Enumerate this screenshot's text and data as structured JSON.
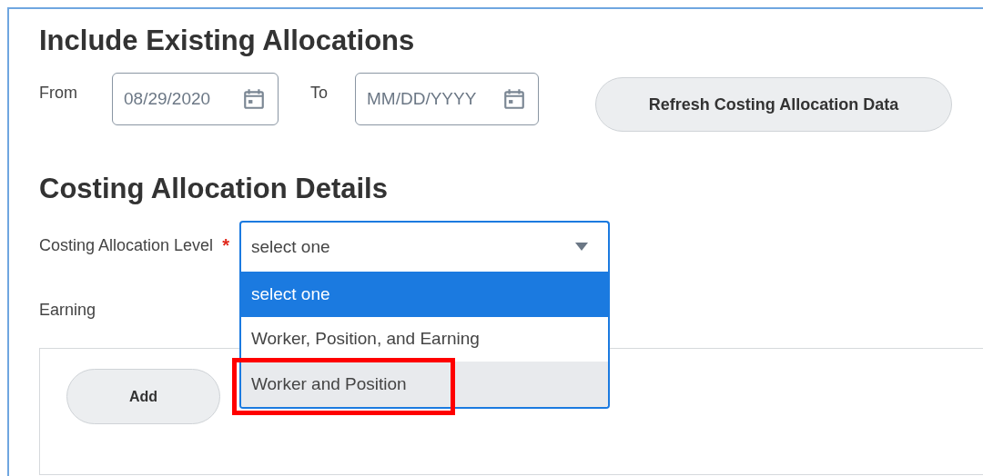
{
  "include_section": {
    "heading": "Include Existing Allocations",
    "from_label": "From",
    "from_value": "08/29/2020",
    "to_label": "To",
    "to_placeholder": "MM/DD/YYYY",
    "refresh_button": "Refresh Costing Allocation Data"
  },
  "details_section": {
    "heading": "Costing Allocation Details",
    "level_label": "Costing Allocation Level",
    "required_mark": "*",
    "level_value": "select one",
    "dropdown_options": [
      {
        "label": "select one",
        "selected": true,
        "hovered": false,
        "annotated": false
      },
      {
        "label": "Worker, Position, and Earning",
        "selected": false,
        "hovered": false,
        "annotated": false
      },
      {
        "label": "Worker and Position",
        "selected": false,
        "hovered": true,
        "annotated": true
      }
    ],
    "earning_label": "Earning",
    "add_button": "Add"
  }
}
